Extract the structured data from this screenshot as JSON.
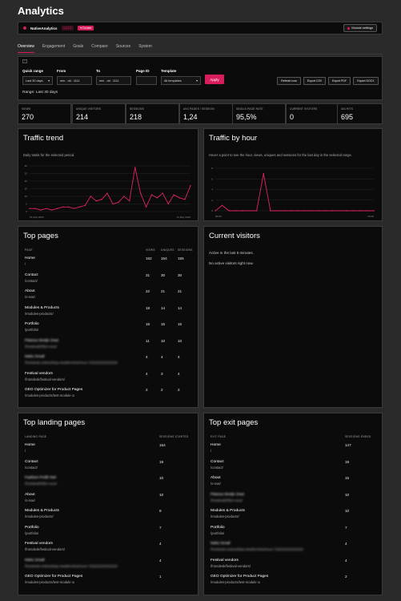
{
  "page": {
    "title": "Analytics"
  },
  "brandbar": {
    "name": "NativeAnalytics",
    "version": "v1.2.0",
    "support": "Donate",
    "module_settings": "Module settings"
  },
  "tabs": [
    "Overview",
    "Engagement",
    "Goals",
    "Compare",
    "Sources",
    "System"
  ],
  "filters": {
    "quick_range_label": "Quick range",
    "quick_range_value": "Last 30 days",
    "from_label": "From",
    "from_value": "mm . dd . 1111",
    "to_label": "To",
    "to_value": "mm . dd . 1111",
    "page_id_label": "Page ID",
    "page_id_value": "",
    "template_label": "Template",
    "template_value": "All templates",
    "apply": "Apply",
    "refresh": "Refresh now",
    "export_csv": "Export CSV",
    "export_pdf": "Export PDF",
    "export_docx": "Export DOCX",
    "range": "Range: Last 30 days"
  },
  "stats": [
    {
      "label": "VIEWS",
      "value": "270"
    },
    {
      "label": "UNIQUE VISITORS",
      "value": "214"
    },
    {
      "label": "SESSIONS",
      "value": "218"
    },
    {
      "label": "AVG PAGES / SESSION",
      "value": "1,24"
    },
    {
      "label": "SINGLE-PAGE RATE",
      "value": "95,5%"
    },
    {
      "label": "CURRENT VISITORS",
      "value": "0"
    },
    {
      "label": "404 HITS",
      "value": "695"
    }
  ],
  "traffic_trend": {
    "title": "Traffic trend",
    "subtitle": "Daily totals for the selected period.",
    "x_start": "15 April 2026",
    "x_end": "14 May 2026"
  },
  "traffic_hour": {
    "title": "Traffic by hour",
    "subtitle": "Hover a point to see the hour, views, uniques and sessions for the last day in the selected range.",
    "x_start": "00:00",
    "x_end": "23:00"
  },
  "chart_data": [
    {
      "type": "line",
      "title": "Traffic trend",
      "y_ticks": [
        "30",
        "25",
        "20",
        "15",
        "10",
        "5",
        "0"
      ],
      "ylim": [
        0,
        30
      ],
      "series": [
        {
          "values": [
            2,
            2,
            1,
            2,
            1,
            2,
            3,
            3,
            2,
            3,
            4,
            10,
            7,
            8,
            12,
            5,
            6,
            10,
            7,
            29,
            12,
            3,
            11,
            9,
            12,
            5,
            11,
            9,
            8,
            17
          ]
        }
      ]
    },
    {
      "type": "line",
      "title": "Traffic by hour",
      "y_ticks": [
        "8",
        "6",
        "4",
        "2",
        "0"
      ],
      "ylim": [
        0,
        8
      ],
      "series": [
        {
          "values": [
            0,
            1,
            0,
            0,
            0,
            0,
            0,
            7,
            0,
            0,
            0,
            0,
            0,
            0,
            0,
            0,
            0,
            0,
            0,
            0,
            0,
            0,
            0,
            0
          ]
        }
      ]
    }
  ],
  "top_pages": {
    "title": "Top pages",
    "headers": [
      "PAGE",
      "VIEWS",
      "UNIQUES",
      "SESSIONS"
    ],
    "rows": [
      {
        "title": "Home",
        "path": "/",
        "v": "162",
        "u": "154",
        "s": "155"
      },
      {
        "title": "Contact",
        "path": "/contact/",
        "v": "31",
        "u": "30",
        "s": "30"
      },
      {
        "title": "About",
        "path": "/o-nas/",
        "v": "22",
        "u": "21",
        "s": "21"
      },
      {
        "title": "Modules & Products",
        "path": "/modules-products/",
        "v": "18",
        "u": "14",
        "s": "14"
      },
      {
        "title": "Portfolio",
        "path": "/portfolio/",
        "v": "16",
        "u": "15",
        "s": "15"
      },
      {
        "title": "Pitanus Dezijn Sout",
        "path": "/frontdesk/hilfen-sout/",
        "v": "11",
        "u": "10",
        "s": "10"
      },
      {
        "title": "Neko Smail",
        "path": "/frontdesk-entries/divja-ziwali/entries/neun-7ZZZZZZZZZZZZZ/",
        "v": "4",
        "u": "4",
        "s": "4"
      },
      {
        "title": "Festival vendors",
        "path": "/frontdesk/festival-vendors/",
        "v": "4",
        "u": "3",
        "s": "4"
      },
      {
        "title": "GEO Optimizer for Product Pages",
        "path": "/modules-products/test-module-1/",
        "v": "2",
        "u": "2",
        "s": "2"
      }
    ]
  },
  "current_visitors": {
    "title": "Current visitors",
    "line1": "Active in the last 5 minutes.",
    "line2": "No active visitors right now."
  },
  "top_landing": {
    "title": "Top landing pages",
    "headers": [
      "LANDING PAGE",
      "SESSIONS STARTED"
    ],
    "rows": [
      {
        "title": "Home",
        "path": "/",
        "n": "154"
      },
      {
        "title": "Contact",
        "path": "/contact/",
        "n": "19"
      },
      {
        "title": "Fashion Profil Hiel",
        "path": "/frontdesk/hilfen-sout/",
        "n": "10"
      },
      {
        "title": "About",
        "path": "/o-nas/",
        "n": "10"
      },
      {
        "title": "Modules & Products",
        "path": "/modules-products/",
        "n": "9"
      },
      {
        "title": "Portfolio",
        "path": "/portfolio/",
        "n": "7"
      },
      {
        "title": "Festival vendors",
        "path": "/frontdesk/festival-vendors/",
        "n": "4"
      },
      {
        "title": "Neko Smail",
        "path": "/frontdesk-entries/divja-ziwali/entries/neun-7ZZZZZZZZZZZZZ/",
        "n": "4"
      },
      {
        "title": "GEO Optimizer for Product Pages",
        "path": "/modules-products/test-module-1/",
        "n": "1"
      }
    ]
  },
  "top_exit": {
    "title": "Top exit pages",
    "headers": [
      "EXIT PAGE",
      "SESSIONS ENDED"
    ],
    "rows": [
      {
        "title": "Home",
        "path": "/",
        "n": "147"
      },
      {
        "title": "Contact",
        "path": "/contact/",
        "n": "19"
      },
      {
        "title": "About",
        "path": "/o-nas/",
        "n": "15"
      },
      {
        "title": "Pitanus Dezijn Sout",
        "path": "/frontdesk/hilfen-sout/",
        "n": "10"
      },
      {
        "title": "Modules & Products",
        "path": "/modules-products/",
        "n": "10"
      },
      {
        "title": "Portfolio",
        "path": "/portfolio/",
        "n": "7"
      },
      {
        "title": "Neko Smail",
        "path": "/frontdesk-entries/divja-ziwali/entries/neun-7ZZZZZZZZZZZZZ/",
        "n": "4"
      },
      {
        "title": "Festival vendors",
        "path": "/frontdesk/festival-vendors/",
        "n": "4"
      },
      {
        "title": "GEO Optimizer for Product Pages",
        "path": "/modules-products/test-module-1/",
        "n": "2"
      }
    ]
  }
}
